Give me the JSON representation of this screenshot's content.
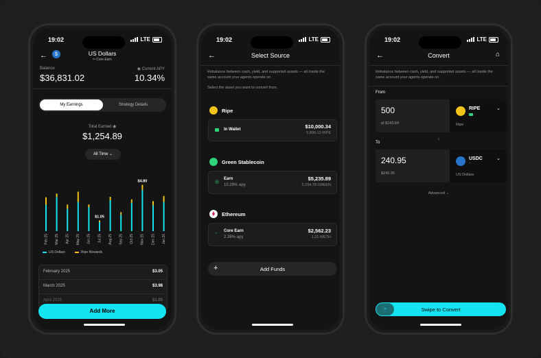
{
  "colors": {
    "accent": "#14e3f2",
    "yellow": "#f2c417",
    "green": "#2fd37a"
  },
  "common": {
    "time": "19:02",
    "network": "LTE"
  },
  "screen1": {
    "title": "US Dollars",
    "subtitle": "ᵘˢ Core Earn",
    "balance_label": "Balance",
    "balance": "$36,831.02",
    "apy_label": "Current APY",
    "apy": "10.34%",
    "tabs": [
      "My Earnings",
      "Strategy Details"
    ],
    "total_label": "Total Earned",
    "total": "$1,254.89",
    "period": "All Time",
    "legend": [
      "US Dollars",
      "Ripe Rewards"
    ],
    "rows": [
      {
        "month": "February 2025",
        "value": "$3.05"
      },
      {
        "month": "March 2025",
        "value": "$3.98"
      },
      {
        "month": "April 2025",
        "value": "$1.05"
      }
    ],
    "button": "Add More"
  },
  "chart_data": {
    "type": "bar",
    "categories": [
      "Feb 25",
      "Mar 25",
      "Apr 25",
      "May 25",
      "Jun 25",
      "Jul 25",
      "Aug 25",
      "Sep 25",
      "Oct 25",
      "Nov 25",
      "Dec 25",
      "Jan 26"
    ],
    "series": [
      {
        "name": "US Dollars",
        "values": [
          3.05,
          3.98,
          2.6,
          3.4,
          2.8,
          1.05,
          3.6,
          1.9,
          3.3,
          4.8,
          3.0,
          3.4
        ]
      },
      {
        "name": "Ripe Rewards",
        "values": [
          0.9,
          0.4,
          0.5,
          1.2,
          0.3,
          0.2,
          0.4,
          0.3,
          0.4,
          0.6,
          0.5,
          0.7
        ]
      }
    ],
    "annotations": [
      "$1.05",
      "$4.80"
    ],
    "stacked": true
  },
  "screen2": {
    "title": "Select Source",
    "desc": "Rebalance between cash, yield, and supported assets — all inside the same account your agents operate on.",
    "prompt": "Select the asset you want to convert from.",
    "groups": [
      {
        "name": "Ripe",
        "rows": [
          {
            "label": "In Wallet",
            "sub": "",
            "value": "$10,000.34",
            "amount": "5,899.12 RIPE"
          }
        ]
      },
      {
        "name": "Green Stablecoin",
        "rows": [
          {
            "label": "Earn",
            "sub": "10.29% apy",
            "value": "$5,235.89",
            "amount": "5,234.78 GREEN"
          }
        ]
      },
      {
        "name": "Ethereum",
        "rows": [
          {
            "label": "Core Earn",
            "sub": "2.38% apy",
            "value": "$2,562.23",
            "amount": "1.21 WETH"
          }
        ]
      }
    ],
    "add_funds": "Add Funds"
  },
  "screen3": {
    "title": "Convert",
    "desc": "Rebalance between cash, yield, and supported assets — all inside the same account your agents operate on.",
    "from_label": "From",
    "from_amount": "500",
    "from_usd": "⇄ $243.84",
    "from_token": "RIPE",
    "from_token_sub": "Ripe",
    "to_label": "To",
    "to_amount": "240.95",
    "to_usd": "$240.95",
    "to_token": "USDC",
    "to_token_sub": "US Dollars",
    "advanced": "Advanced ⌄",
    "swipe": "Swipe to Convert"
  }
}
